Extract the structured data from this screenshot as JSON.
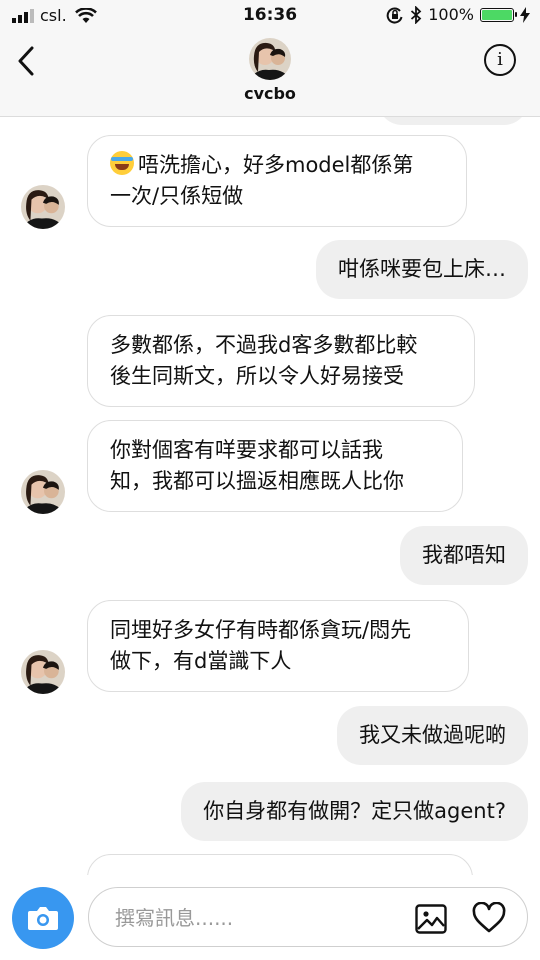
{
  "status": {
    "carrier": "csl.",
    "time": "16:36",
    "battery": "100%",
    "battery_level": 1.0
  },
  "header": {
    "username": "cvcbo"
  },
  "messages": [
    {
      "side": "in",
      "text": "唔洗擔心，好多model都係第一次/只係短做",
      "lines": [
        "唔洗擔心，好多model都係第",
        "一次/只係短做"
      ],
      "emoji": "joy-emoji"
    },
    {
      "side": "out",
      "text": "咁係咪要包上床…",
      "lines": [
        "咁係咪要包上床…"
      ]
    },
    {
      "side": "in",
      "text": "多數都係，不過我d客多數都比較後生同斯文，所以令人好易接受",
      "lines": [
        "多數都係，不過我d客多數都比較",
        "後生同斯文，所以令人好易接受"
      ]
    },
    {
      "side": "in",
      "text": "你對個客有咩要求都可以話我知，我都可以搵返相應既人比你",
      "lines": [
        "你對個客有咩要求都可以話我",
        "知，我都可以搵返相應既人比你"
      ]
    },
    {
      "side": "out",
      "text": "我都唔知",
      "lines": [
        "我都唔知"
      ]
    },
    {
      "side": "in",
      "text": "同埋好多女仔有時都係貪玩/悶先做下，有d當識下人",
      "lines": [
        "同埋好多女仔有時都係貪玩/悶先",
        "做下，有d當識下人"
      ]
    },
    {
      "side": "out",
      "text": "我又未做過呢啲",
      "lines": [
        "我又未做過呢啲"
      ]
    },
    {
      "side": "out",
      "text": "你自身都有做開？定只做agent?",
      "lines": [
        "你自身都有做開？定只做agent?"
      ]
    }
  ],
  "composer": {
    "placeholder": "撰寫訊息......"
  },
  "colors": {
    "accent": "#3897f0",
    "incoming_bubble": "#ffffff",
    "outgoing_bubble": "#efefef",
    "battery_fill": "#4cd964"
  },
  "icons": {
    "back": "chevron-left-icon",
    "info": "info-icon",
    "camera": "camera-icon",
    "gallery": "gallery-icon",
    "heart": "heart-icon"
  }
}
